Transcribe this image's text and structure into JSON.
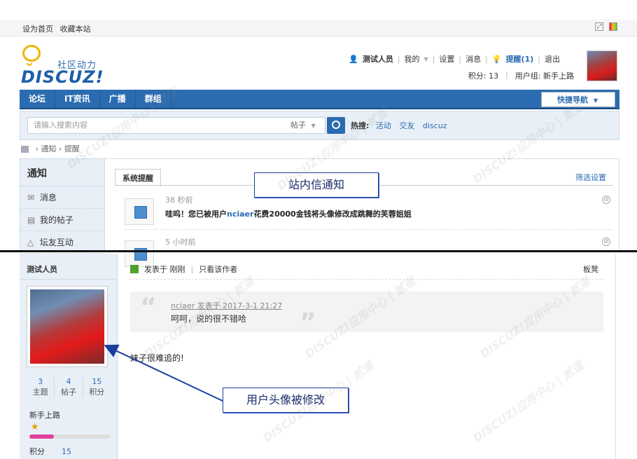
{
  "topbar": {
    "set_home": "设为首页",
    "bookmark": "收藏本站"
  },
  "logo": {
    "subtitle": "社区动力",
    "wordmark": "DISCUZ!"
  },
  "user": {
    "name": "测试人员",
    "my": "我的",
    "settings": "设置",
    "messages": "消息",
    "remind": "提醒(1)",
    "logout": "退出",
    "points": "积分: 13",
    "group": "用户组: 新手上路"
  },
  "nav": {
    "items": [
      "论坛",
      "IT资讯",
      "广播",
      "群组"
    ],
    "quick": "快捷导航"
  },
  "search": {
    "placeholder": "请输入搜索内容",
    "type": "帖子",
    "hot_label": "热搜:",
    "hot_terms": [
      "活动",
      "交友",
      "discuz"
    ]
  },
  "breadcrumb": {
    "items": [
      "通知",
      "提醒"
    ]
  },
  "notice_sidebar": {
    "title": "通知",
    "items": [
      "消息",
      "我的帖子",
      "坛友互动"
    ]
  },
  "notice_panel": {
    "tab": "系统提醒",
    "filter": "筛选设置",
    "items": [
      {
        "time": "38 秒前",
        "text_before": "哇呜！您已被用户",
        "link": "nciaer",
        "text_after": "花费20000金钱将头像修改成跳舞的芙蓉姐姐"
      },
      {
        "time": "5 小时前"
      }
    ]
  },
  "callouts": {
    "inbox": "站内信通知",
    "avatar_changed": "用户头像被修改"
  },
  "post": {
    "author": "测试人员",
    "stats": [
      {
        "value": "3",
        "label": "主题"
      },
      {
        "value": "4",
        "label": "帖子"
      },
      {
        "value": "15",
        "label": "积分"
      }
    ],
    "group": "新手上路",
    "progress": 0.3,
    "score_label": "积分",
    "score_value": "15",
    "posted": "发表于 刚刚",
    "author_only": "只看该作者",
    "floor": "板凳",
    "quote_author": "nciaer 发表于 2017-3-1 21:27",
    "quote_text": "呵呵，说的很不错哈",
    "body": "妹子很难追的!"
  },
  "colors": {
    "brand": "#2b6cb0",
    "accent": "#e040a0",
    "callout_border": "#1a3fa0"
  },
  "watermark": "DISCUZ!应用中心 | 贰道"
}
